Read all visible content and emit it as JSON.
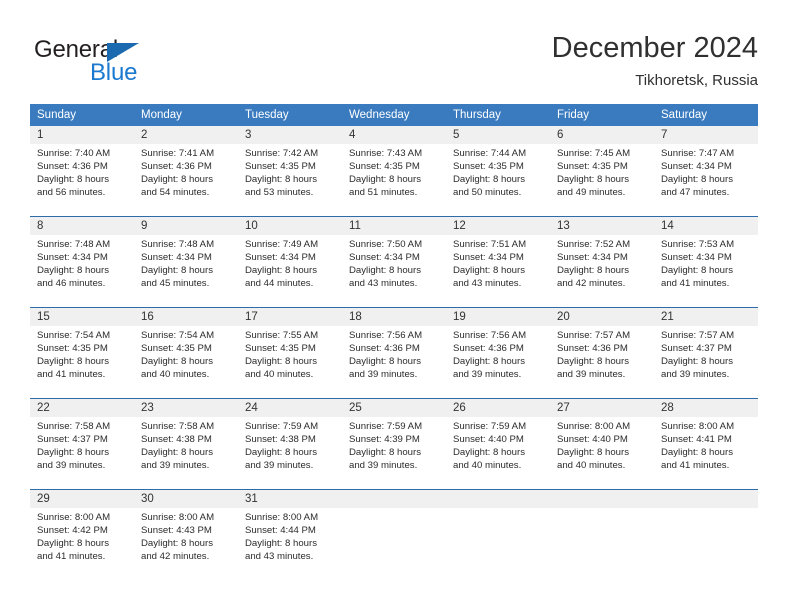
{
  "logo": {
    "word_top": "General",
    "word_bottom": "Blue",
    "triangle_color": "#1b6ab0",
    "blue_color": "#1b7ad0"
  },
  "header": {
    "title": "December 2024",
    "subtitle": "Tikhoretsk, Russia"
  },
  "theme": {
    "header_blue": "#3a7bbf",
    "row_rule_blue": "#2d6ca8",
    "daynum_band": "#f0f0f0"
  },
  "weekday_headers": [
    "Sunday",
    "Monday",
    "Tuesday",
    "Wednesday",
    "Thursday",
    "Friday",
    "Saturday"
  ],
  "weeks": [
    {
      "days": [
        {
          "num": "1",
          "sunrise": "Sunrise: 7:40 AM",
          "sunset": "Sunset: 4:36 PM",
          "daylight1": "Daylight: 8 hours",
          "daylight2": "and 56 minutes."
        },
        {
          "num": "2",
          "sunrise": "Sunrise: 7:41 AM",
          "sunset": "Sunset: 4:36 PM",
          "daylight1": "Daylight: 8 hours",
          "daylight2": "and 54 minutes."
        },
        {
          "num": "3",
          "sunrise": "Sunrise: 7:42 AM",
          "sunset": "Sunset: 4:35 PM",
          "daylight1": "Daylight: 8 hours",
          "daylight2": "and 53 minutes."
        },
        {
          "num": "4",
          "sunrise": "Sunrise: 7:43 AM",
          "sunset": "Sunset: 4:35 PM",
          "daylight1": "Daylight: 8 hours",
          "daylight2": "and 51 minutes."
        },
        {
          "num": "5",
          "sunrise": "Sunrise: 7:44 AM",
          "sunset": "Sunset: 4:35 PM",
          "daylight1": "Daylight: 8 hours",
          "daylight2": "and 50 minutes."
        },
        {
          "num": "6",
          "sunrise": "Sunrise: 7:45 AM",
          "sunset": "Sunset: 4:35 PM",
          "daylight1": "Daylight: 8 hours",
          "daylight2": "and 49 minutes."
        },
        {
          "num": "7",
          "sunrise": "Sunrise: 7:47 AM",
          "sunset": "Sunset: 4:34 PM",
          "daylight1": "Daylight: 8 hours",
          "daylight2": "and 47 minutes."
        }
      ]
    },
    {
      "days": [
        {
          "num": "8",
          "sunrise": "Sunrise: 7:48 AM",
          "sunset": "Sunset: 4:34 PM",
          "daylight1": "Daylight: 8 hours",
          "daylight2": "and 46 minutes."
        },
        {
          "num": "9",
          "sunrise": "Sunrise: 7:48 AM",
          "sunset": "Sunset: 4:34 PM",
          "daylight1": "Daylight: 8 hours",
          "daylight2": "and 45 minutes."
        },
        {
          "num": "10",
          "sunrise": "Sunrise: 7:49 AM",
          "sunset": "Sunset: 4:34 PM",
          "daylight1": "Daylight: 8 hours",
          "daylight2": "and 44 minutes."
        },
        {
          "num": "11",
          "sunrise": "Sunrise: 7:50 AM",
          "sunset": "Sunset: 4:34 PM",
          "daylight1": "Daylight: 8 hours",
          "daylight2": "and 43 minutes."
        },
        {
          "num": "12",
          "sunrise": "Sunrise: 7:51 AM",
          "sunset": "Sunset: 4:34 PM",
          "daylight1": "Daylight: 8 hours",
          "daylight2": "and 43 minutes."
        },
        {
          "num": "13",
          "sunrise": "Sunrise: 7:52 AM",
          "sunset": "Sunset: 4:34 PM",
          "daylight1": "Daylight: 8 hours",
          "daylight2": "and 42 minutes."
        },
        {
          "num": "14",
          "sunrise": "Sunrise: 7:53 AM",
          "sunset": "Sunset: 4:34 PM",
          "daylight1": "Daylight: 8 hours",
          "daylight2": "and 41 minutes."
        }
      ]
    },
    {
      "days": [
        {
          "num": "15",
          "sunrise": "Sunrise: 7:54 AM",
          "sunset": "Sunset: 4:35 PM",
          "daylight1": "Daylight: 8 hours",
          "daylight2": "and 41 minutes."
        },
        {
          "num": "16",
          "sunrise": "Sunrise: 7:54 AM",
          "sunset": "Sunset: 4:35 PM",
          "daylight1": "Daylight: 8 hours",
          "daylight2": "and 40 minutes."
        },
        {
          "num": "17",
          "sunrise": "Sunrise: 7:55 AM",
          "sunset": "Sunset: 4:35 PM",
          "daylight1": "Daylight: 8 hours",
          "daylight2": "and 40 minutes."
        },
        {
          "num": "18",
          "sunrise": "Sunrise: 7:56 AM",
          "sunset": "Sunset: 4:36 PM",
          "daylight1": "Daylight: 8 hours",
          "daylight2": "and 39 minutes."
        },
        {
          "num": "19",
          "sunrise": "Sunrise: 7:56 AM",
          "sunset": "Sunset: 4:36 PM",
          "daylight1": "Daylight: 8 hours",
          "daylight2": "and 39 minutes."
        },
        {
          "num": "20",
          "sunrise": "Sunrise: 7:57 AM",
          "sunset": "Sunset: 4:36 PM",
          "daylight1": "Daylight: 8 hours",
          "daylight2": "and 39 minutes."
        },
        {
          "num": "21",
          "sunrise": "Sunrise: 7:57 AM",
          "sunset": "Sunset: 4:37 PM",
          "daylight1": "Daylight: 8 hours",
          "daylight2": "and 39 minutes."
        }
      ]
    },
    {
      "days": [
        {
          "num": "22",
          "sunrise": "Sunrise: 7:58 AM",
          "sunset": "Sunset: 4:37 PM",
          "daylight1": "Daylight: 8 hours",
          "daylight2": "and 39 minutes."
        },
        {
          "num": "23",
          "sunrise": "Sunrise: 7:58 AM",
          "sunset": "Sunset: 4:38 PM",
          "daylight1": "Daylight: 8 hours",
          "daylight2": "and 39 minutes."
        },
        {
          "num": "24",
          "sunrise": "Sunrise: 7:59 AM",
          "sunset": "Sunset: 4:38 PM",
          "daylight1": "Daylight: 8 hours",
          "daylight2": "and 39 minutes."
        },
        {
          "num": "25",
          "sunrise": "Sunrise: 7:59 AM",
          "sunset": "Sunset: 4:39 PM",
          "daylight1": "Daylight: 8 hours",
          "daylight2": "and 39 minutes."
        },
        {
          "num": "26",
          "sunrise": "Sunrise: 7:59 AM",
          "sunset": "Sunset: 4:40 PM",
          "daylight1": "Daylight: 8 hours",
          "daylight2": "and 40 minutes."
        },
        {
          "num": "27",
          "sunrise": "Sunrise: 8:00 AM",
          "sunset": "Sunset: 4:40 PM",
          "daylight1": "Daylight: 8 hours",
          "daylight2": "and 40 minutes."
        },
        {
          "num": "28",
          "sunrise": "Sunrise: 8:00 AM",
          "sunset": "Sunset: 4:41 PM",
          "daylight1": "Daylight: 8 hours",
          "daylight2": "and 41 minutes."
        }
      ]
    },
    {
      "days": [
        {
          "num": "29",
          "sunrise": "Sunrise: 8:00 AM",
          "sunset": "Sunset: 4:42 PM",
          "daylight1": "Daylight: 8 hours",
          "daylight2": "and 41 minutes."
        },
        {
          "num": "30",
          "sunrise": "Sunrise: 8:00 AM",
          "sunset": "Sunset: 4:43 PM",
          "daylight1": "Daylight: 8 hours",
          "daylight2": "and 42 minutes."
        },
        {
          "num": "31",
          "sunrise": "Sunrise: 8:00 AM",
          "sunset": "Sunset: 4:44 PM",
          "daylight1": "Daylight: 8 hours",
          "daylight2": "and 43 minutes."
        },
        {
          "num": "",
          "sunrise": "",
          "sunset": "",
          "daylight1": "",
          "daylight2": ""
        },
        {
          "num": "",
          "sunrise": "",
          "sunset": "",
          "daylight1": "",
          "daylight2": ""
        },
        {
          "num": "",
          "sunrise": "",
          "sunset": "",
          "daylight1": "",
          "daylight2": ""
        },
        {
          "num": "",
          "sunrise": "",
          "sunset": "",
          "daylight1": "",
          "daylight2": ""
        }
      ]
    }
  ]
}
